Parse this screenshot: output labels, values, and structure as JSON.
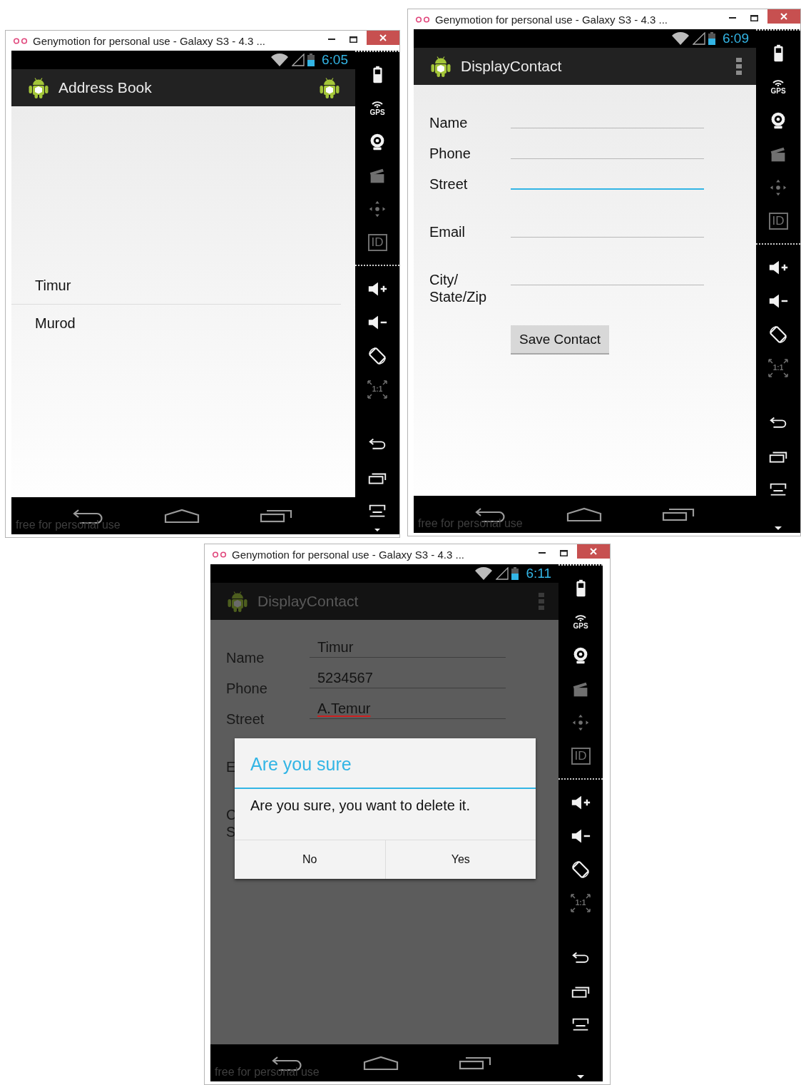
{
  "windows": [
    {
      "title": "Genymotion for personal use - Galaxy S3 - 4.3 ...",
      "time": "6:05",
      "app_title": "Address Book",
      "action_items": [
        {
          "kind": "app-icon"
        }
      ],
      "dimmed": false,
      "kind": "list",
      "contacts": [
        {
          "name": "Timur"
        },
        {
          "name": "Murod"
        }
      ],
      "notice": "free for personal use",
      "toolbar": [
        [
          {
            "kind": "battery",
            "disabled": false
          },
          {
            "kind": "gps",
            "text": "GPS",
            "disabled": false
          },
          {
            "kind": "camera",
            "disabled": false
          },
          {
            "kind": "video",
            "disabled": true
          },
          {
            "kind": "dpad",
            "disabled": true
          },
          {
            "kind": "id",
            "text": "ID",
            "disabled": true
          }
        ],
        [
          {
            "kind": "volume-up",
            "disabled": false
          },
          {
            "kind": "volume-down",
            "disabled": false
          },
          {
            "kind": "rotate",
            "disabled": false
          },
          {
            "kind": "scale",
            "text": "1:1",
            "disabled": true
          },
          {
            "kind": "back",
            "disabled": false
          },
          {
            "kind": "recent",
            "disabled": false
          },
          {
            "kind": "menu",
            "disabled": false
          }
        ]
      ]
    },
    {
      "title": "Genymotion for personal use - Galaxy S3 - 4.3 ...",
      "time": "6:09",
      "app_title": "DisplayContact",
      "action_items": [
        {
          "kind": "overflow"
        }
      ],
      "dimmed": false,
      "kind": "form",
      "fields": [
        {
          "kind": "input",
          "label": [
            "Name"
          ],
          "focused": false
        },
        {
          "kind": "input",
          "label": [
            "Phone"
          ],
          "focused": false
        },
        {
          "kind": "input",
          "label": [
            "Street"
          ],
          "focused": true
        },
        {
          "kind": "input",
          "label": [
            "Email"
          ],
          "focused": false
        },
        {
          "kind": "input",
          "label": [
            "City/",
            "State/Zip"
          ],
          "focused": false
        }
      ],
      "button": "Save Contact",
      "notice": "free for personal use",
      "toolbar": [
        [
          {
            "kind": "battery",
            "disabled": false
          },
          {
            "kind": "gps",
            "text": "GPS",
            "disabled": false
          },
          {
            "kind": "camera",
            "disabled": false
          },
          {
            "kind": "video",
            "disabled": true
          },
          {
            "kind": "dpad",
            "disabled": true
          },
          {
            "kind": "id",
            "text": "ID",
            "disabled": true
          }
        ],
        [
          {
            "kind": "volume-up",
            "disabled": false
          },
          {
            "kind": "volume-down",
            "disabled": false
          },
          {
            "kind": "rotate",
            "disabled": false
          },
          {
            "kind": "scale",
            "text": "1:1",
            "disabled": true
          },
          {
            "kind": "back",
            "disabled": false
          },
          {
            "kind": "recent",
            "disabled": false
          },
          {
            "kind": "menu",
            "disabled": false
          }
        ]
      ]
    },
    {
      "title": "Genymotion for personal use - Galaxy S3 - 4.3 ...",
      "time": "6:11",
      "app_title": "DisplayContact",
      "action_items": [
        {
          "kind": "overflow"
        }
      ],
      "dimmed": true,
      "kind": "form",
      "fields": [
        {
          "kind": "input",
          "label": [
            "Name"
          ],
          "value": "Timur",
          "focused": false,
          "misspelled": false
        },
        {
          "kind": "input",
          "label": [
            "Phone"
          ],
          "value": "5234567",
          "focused": false,
          "misspelled": false
        },
        {
          "kind": "input",
          "label": [
            "Street"
          ],
          "value": "A.Temur",
          "focused": false,
          "misspelled": true
        },
        {
          "kind": "label",
          "label": [
            "E"
          ]
        },
        {
          "kind": "label",
          "label": [
            "C",
            "S"
          ]
        }
      ],
      "dialog": {
        "title": "Are you sure",
        "message": "Are you sure, you want to delete it.",
        "buttons": [
          "No",
          "Yes"
        ]
      },
      "notice": "free for personal use",
      "toolbar": [
        [
          {
            "kind": "battery",
            "disabled": false
          },
          {
            "kind": "gps",
            "text": "GPS",
            "disabled": false
          },
          {
            "kind": "camera",
            "disabled": false
          },
          {
            "kind": "video",
            "disabled": true
          },
          {
            "kind": "dpad",
            "disabled": true
          },
          {
            "kind": "id",
            "text": "ID",
            "disabled": true
          }
        ],
        [
          {
            "kind": "volume-up",
            "disabled": false
          },
          {
            "kind": "volume-down",
            "disabled": false
          },
          {
            "kind": "rotate",
            "disabled": false
          },
          {
            "kind": "scale",
            "text": "1:1",
            "disabled": true
          },
          {
            "kind": "back",
            "disabled": false
          },
          {
            "kind": "recent",
            "disabled": false
          },
          {
            "kind": "menu",
            "disabled": false
          }
        ]
      ]
    }
  ]
}
